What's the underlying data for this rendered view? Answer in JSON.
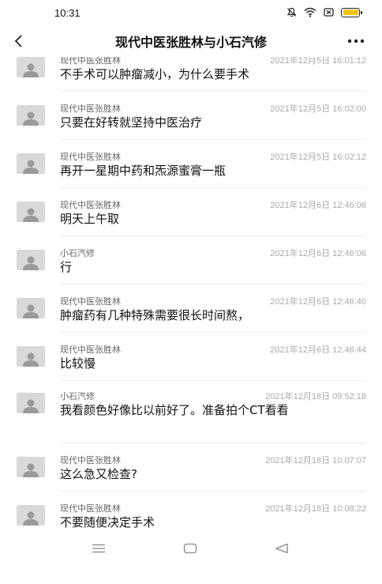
{
  "status_bar": {
    "time": "10:31",
    "icons": [
      "mute-icon",
      "wifi-icon",
      "sim-icon",
      "battery-icon"
    ],
    "battery_color": "#f0c419"
  },
  "nav": {
    "title": "现代中医张胜林与小石汽修",
    "back_icon": "chevron-left-icon",
    "more_icon": "more-icon"
  },
  "messages": [
    {
      "sender": "现代中医张胜林",
      "time": "2021年12月5日 16:01:12",
      "text": "不手术可以肿瘤减小，为什么要手术"
    },
    {
      "sender": "现代中医张胜林",
      "time": "2021年12月5日 16:02:00",
      "text": "只要在好转就坚持中医治疗"
    },
    {
      "sender": "现代中医张胜林",
      "time": "2021年12月5日 16:02:12",
      "text": "再开一星期中药和炁源蜜膏一瓶"
    },
    {
      "sender": "现代中医张胜林",
      "time": "2021年12月6日 12:46:06",
      "text": "明天上午取"
    },
    {
      "sender": "小石汽修",
      "time": "2021年12月6日 12:46:06",
      "text": "行"
    },
    {
      "sender": "现代中医张胜林",
      "time": "2021年12月6日 12:46:40",
      "text": "肿瘤药有几种特殊需要很长时间熬，"
    },
    {
      "sender": "现代中医张胜林",
      "time": "2021年12月6日 12:46:44",
      "text": "比较慢"
    },
    {
      "sender": "小石汽修",
      "time": "2021年12月18日 09:52:18",
      "text": "我看颜色好像比以前好了。准备拍个CT看看"
    },
    {
      "sender": "现代中医张胜林",
      "time": "2021年12月18日 10:07:07",
      "text": "这么急又检查?"
    },
    {
      "sender": "现代中医张胜林",
      "time": "2021年12月18日 10:08:22",
      "text": "不要随便决定手术"
    }
  ],
  "bottom_nav": {
    "icons": [
      "menu-icon",
      "home-icon",
      "back-triangle-icon"
    ]
  }
}
